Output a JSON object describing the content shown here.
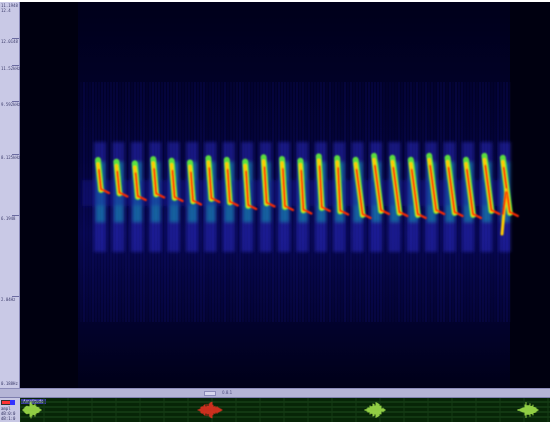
{
  "ruler": {
    "labels": [
      "11.1948",
      "12.4",
      "12.0148",
      "11.52kHz",
      "9.592kHz",
      "8.125kHz",
      "6.1948",
      "2.04Hz",
      "0.188Hz"
    ],
    "background": "#c9c9e6"
  },
  "spectrogram": {
    "background": "#000018",
    "colormap": [
      "#000018",
      "#1a1aa0",
      "#3f3fff",
      "#00ffcc",
      "#66ff33",
      "#ffcc00",
      "#ff2a00"
    ]
  },
  "divider": {
    "scroll_label": "0.8.1"
  },
  "overview": {
    "title": "Amplitude",
    "controls": [
      "ampl",
      "dB:0:0",
      "dB:1:0"
    ],
    "background": "#072507",
    "wave_color": "#9fe04a",
    "highlight_color": "#e03020"
  }
}
